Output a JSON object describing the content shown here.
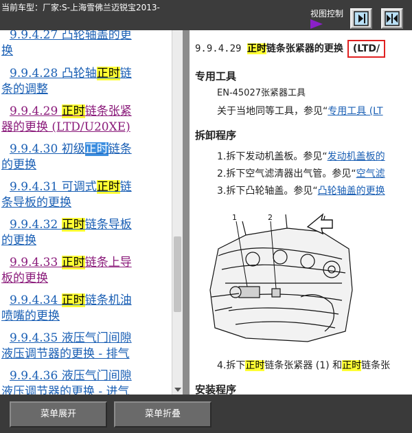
{
  "header": {
    "car_model": "当前车型：厂家:S-上海雪佛兰迈锐宝2013-",
    "view_control": "视图控制"
  },
  "toc": {
    "items": [
      {
        "line1": "9.9.4.27 凸轮轴盖的",
        "line2": "换",
        "hl": "",
        "after1": "更",
        "color": "blue"
      },
      {
        "pre": "9.9.4.28 凸轮轴",
        "hl": "正时",
        "post": "链",
        "line2": "条的调整",
        "color": "blue"
      },
      {
        "pre": "9.9.4.29 ",
        "hl": "正时",
        "post": "链条张紧",
        "line2": "器的更换 (LTD/U20XE)",
        "color": "purple"
      },
      {
        "pre": "9.9.4.30 初级",
        "hl": "正时",
        "post": "链条",
        "line2": "的更换",
        "color": "blue",
        "selected": true
      },
      {
        "pre": "9.9.4.31 可调式",
        "hl": "正时",
        "post": "链",
        "line2": "条导板的更换",
        "color": "blue"
      },
      {
        "pre": "9.9.4.32 ",
        "hl": "正时",
        "post": "链条导板",
        "line2": "的更换",
        "color": "blue"
      },
      {
        "pre": "9.9.4.33 ",
        "hl": "正时",
        "post": "链条上导",
        "line2": "板的更换",
        "color": "purple"
      },
      {
        "pre": "9.9.4.34 ",
        "hl": "正时",
        "post": "链条机油",
        "line2": "喷嘴的更换",
        "color": "blue"
      },
      {
        "pre": "9.9.4.35 液压气门间隙",
        "hl": "",
        "post": "",
        "line2": "液压调节器的更换 - 排气",
        "color": "blue"
      },
      {
        "pre": "9.9.4.36 液压气门间隙",
        "hl": "",
        "post": "",
        "line2": "液压调节器的更换 - 进气",
        "color": "blue"
      }
    ]
  },
  "content": {
    "title_num": "9.9.4.29 ",
    "title_hl": "正时",
    "title_text": "链条张紧器的更换",
    "title_box": "(LTD/",
    "special_tools_heading": "专用工具",
    "tool_line": "EN-45027张紧器工具",
    "tool_ref_pre": "关于当地同等工具，参见“",
    "tool_ref_link": "专用工具 (LT",
    "removal_heading": "拆卸程序",
    "step1_pre": "1.拆下发动机盖板。参见“",
    "step1_link": "发动机盖板的",
    "step2_pre": "2.拆下空气滤清器出气管。参见“",
    "step2_link": "空气滤",
    "step3_pre": "3.拆下凸轮轴盖。参见“",
    "step3_link": "凸轮轴盖的更换",
    "callout1": "1",
    "callout2": "2",
    "step4_pre": "4.拆下",
    "step4_hl1": "正时",
    "step4_mid": "链条张紧器 (1) 和",
    "step4_hl2": "正时",
    "step4_post": "链条张",
    "install_heading": "安装程序"
  },
  "footer": {
    "expand_label": "菜单展开",
    "collapse_label": "菜单折叠"
  }
}
